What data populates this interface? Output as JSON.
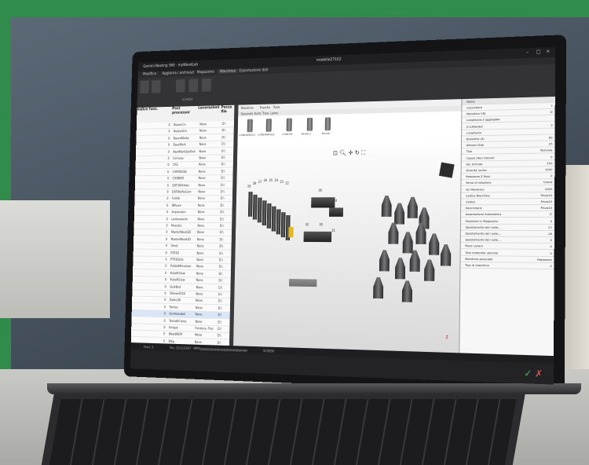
{
  "window": {
    "title_left": "Gemini Nesting 360 · myWoodLab",
    "title_center": "modello27102"
  },
  "menu": [
    "Modifica",
    "Aggiorna / archivazi",
    "Magazzino",
    "Macchina",
    "Esportazione dati"
  ],
  "ribbon": {
    "group_label": "SCHEDA"
  },
  "tool_table": {
    "headers": [
      "Indice funz.",
      "Post processor",
      "Lavorazioni",
      "Pezza file"
    ],
    "rows": [
      [
        "0",
        "BaseeCin",
        "None",
        "D:\\"
      ],
      [
        "0",
        "NestedCin",
        "None",
        "D:\\"
      ],
      [
        "0",
        "BaseeMarky",
        "None",
        "D:\\"
      ],
      [
        "0",
        "BaseMerk",
        "None",
        "D:\\"
      ],
      [
        "0",
        "NestMarkSanEnd",
        "None",
        "D:\\"
      ],
      [
        "0",
        "Cemaux",
        "None",
        "D:\\"
      ],
      [
        "0",
        "CRE",
        "None",
        "D:\\"
      ],
      [
        "0",
        "CARREGSE",
        "None",
        "D:\\"
      ],
      [
        "0",
        "CODNIDI",
        "None",
        "D:\\"
      ],
      [
        "0",
        "DXF30Profee",
        "None",
        "D:\\"
      ],
      [
        "0",
        "DXFWolfieCam",
        "None",
        "D:\\"
      ],
      [
        "0",
        "Fortell",
        "None",
        "D:\\"
      ],
      [
        "0",
        "IMAuse",
        "None",
        "D:\\"
      ],
      [
        "0",
        "Impression",
        "None",
        "D:\\"
      ],
      [
        "0",
        "LonkoswerIn",
        "None",
        "D:\\"
      ],
      [
        "0",
        "Maestro",
        "None",
        "D:\\"
      ],
      [
        "0",
        "MasterWood2D",
        "None",
        "D:\\"
      ],
      [
        "0",
        "MasterWood3D",
        "None",
        "D:\\"
      ],
      [
        "0",
        "Omet",
        "None",
        "D:\\"
      ],
      [
        "0",
        "PTP3D",
        "None",
        "D:\\"
      ],
      [
        "0",
        "PTP3Dshe",
        "None",
        "D:\\"
      ],
      [
        "0",
        "PuliziaMimotare",
        "None",
        "D:\\"
      ],
      [
        "0",
        "PuliziRiGew",
        "None",
        "D:\\"
      ],
      [
        "0",
        "PuliziRiGew",
        "None",
        "D:\\"
      ],
      [
        "0",
        "QuikBed",
        "None",
        "D:\\"
      ],
      [
        "0",
        "Tallexo3518",
        "None",
        "D:\\"
      ],
      [
        "0",
        "Ziefro38",
        "None",
        "D:\\"
      ],
      [
        "0",
        "Torrtec",
        "None",
        "D:\\"
      ],
      [
        "0",
        "SonteoLabel",
        "None",
        "D:\\"
      ],
      [
        "0",
        "TecnoEli lerec",
        "None",
        "D:\\"
      ],
      [
        "0",
        "Unique",
        "Foratura, Fres",
        "D:\\"
      ],
      [
        "0",
        "WoodWOP",
        "None",
        "D:\\"
      ],
      [
        "0",
        "Weg",
        "None",
        "D:\\"
      ]
    ]
  },
  "tool_panel": {
    "tabs": [
      "Mandrino",
      "Tranche",
      "Tools"
    ],
    "subtabs": [
      "Generale",
      "Kurts",
      "Trass",
      "Lame"
    ],
    "tools": [
      "CONO40RG11",
      "CONO40RG12",
      "CONO33",
      "Rinvio 2",
      "Rinvio"
    ]
  },
  "viewport": {
    "toolbar_icons": [
      "zoom-fit-icon",
      "zoom-icon",
      "pan-icon",
      "rotate-icon",
      "expand-icon"
    ],
    "labels": [
      "29",
      "28",
      "27",
      "26",
      "25",
      "24",
      "23",
      "22",
      "36",
      "34",
      "32",
      "30",
      "31"
    ],
    "axis": "Z"
  },
  "properties": {
    "header": "Nome",
    "rows": [
      [
        "Connettore",
        "1"
      ],
      [
        "Mandrino CNI",
        "☑"
      ],
      [
        "Lunghezza Z aggregato",
        ""
      ],
      [
        "Z LUNGHEZ",
        "0"
      ],
      [
        "Lunghezza",
        ""
      ],
      [
        "Diametro (d)",
        "60"
      ],
      [
        "Altezza Utile",
        "25"
      ],
      [
        "Tipo",
        "Nunvula"
      ],
      [
        "Classe Uten Utensili",
        "0"
      ],
      [
        "Vel. Entrata",
        "250"
      ],
      [
        "Velocità uscita",
        "1000"
      ],
      [
        "Rotazione Z fisso",
        "0"
      ],
      [
        "Verso di rotazione",
        "Orario"
      ],
      [
        "Gir Mandrino",
        "2000"
      ],
      [
        "Codice Macchina",
        "Pinza10"
      ],
      [
        "Codice",
        "Pinza10"
      ],
      [
        "Descrizione",
        "Pinza10"
      ],
      [
        "Associazione Automatica",
        "☐"
      ],
      [
        "Posizione in Magazzino",
        "0"
      ],
      [
        "Spostamento del ruote…",
        "27"
      ],
      [
        "Spostamento del ruote…",
        "-16"
      ],
      [
        "Spostamento del ruote…",
        "0"
      ],
      [
        "Posiz Lavoro",
        "0"
      ],
      [
        "Tipo materiale utensile",
        "0"
      ],
      [
        "Mandrino associato",
        "Rotazione"
      ],
      [
        "Tipo di mandrino",
        "0"
      ]
    ]
  },
  "status": {
    "left": "Posiz. 2",
    "mid": "Pos: 25/12/2007 - PPPPpppppppppppppppppppppppppppp",
    "center": "SCHEDA"
  },
  "footer": {
    "confirm": "✓",
    "cancel": "✗"
  }
}
